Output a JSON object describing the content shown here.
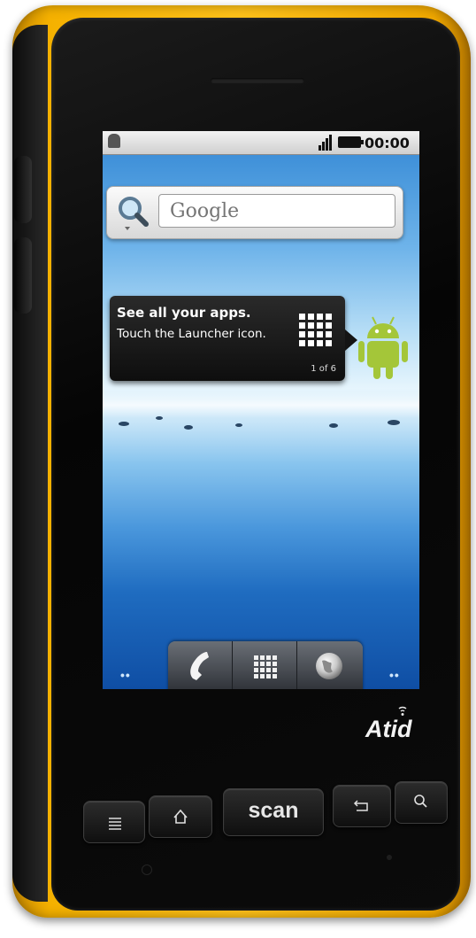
{
  "status_bar": {
    "time": "00:00",
    "notification_icon": "android-debug-icon",
    "signal_icon": "signal-icon",
    "battery_icon": "battery-icon"
  },
  "search_widget": {
    "placeholder": "Google",
    "icon": "search-icon"
  },
  "launcher_tip": {
    "title": "See all your apps.",
    "body": "Touch the Launcher icon.",
    "pager": "1 of 6",
    "icon": "launcher-grid-icon"
  },
  "dock": {
    "left_dots": "••",
    "right_dots": "••",
    "items": [
      "phone-icon",
      "launcher-icon",
      "browser-icon"
    ]
  },
  "brand": {
    "name": "Atid"
  },
  "hardware_keys": {
    "menu_icon": "menu-icon",
    "home_icon": "home-icon",
    "scan_label": "scan",
    "back_icon": "back-icon",
    "search_icon": "search-icon"
  },
  "colors": {
    "bumper": "#ffc21a",
    "bezel": "#0b0b0b",
    "wallpaper_top": "#3d8fd8",
    "wallpaper_bottom": "#0f4ea4",
    "android_green": "#a4c639"
  }
}
